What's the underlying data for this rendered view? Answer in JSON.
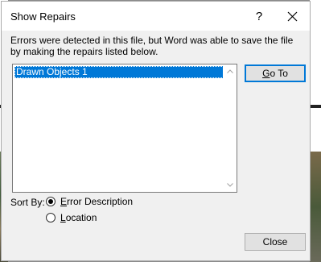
{
  "dialog": {
    "title": "Show Repairs",
    "help_symbol": "?",
    "message": "Errors were detected in this file, but Word was able to save the file by making the repairs listed below.",
    "repairs": [
      "Drawn Objects 1"
    ],
    "goto_label": "Go To",
    "close_label": "Close",
    "sortby_label": "Sort By:",
    "sort_options": [
      {
        "label": "Error Description",
        "selected": true
      },
      {
        "label": "Location",
        "selected": false
      }
    ]
  },
  "colors": {
    "selection": "#0078d7",
    "dialog_bg": "#f0f0f0"
  }
}
